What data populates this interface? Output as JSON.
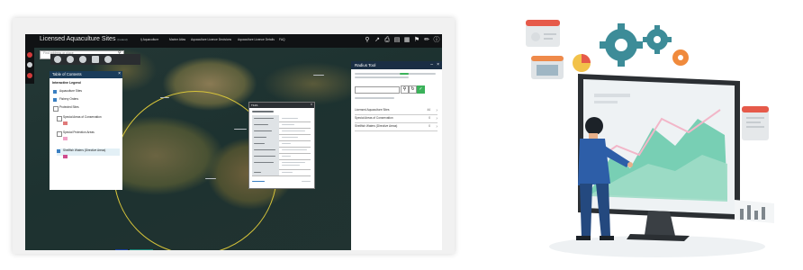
{
  "app": {
    "title": "Licensed Aquaculture Sites",
    "subtitle": "(Ireland)",
    "nav": [
      "i) Aquaculture",
      "Marine Atlas",
      "Aquaculture Licence Decisions",
      "Aquaculture Licence Details",
      "FAQ"
    ],
    "search_placeholder": "Find address or place"
  },
  "toc": {
    "title": "Table of Contents",
    "legend_title": "Interactive Legend",
    "items": [
      {
        "label": "Aquaculture Sites",
        "checked": true,
        "swatch_color": "#3a7fc2"
      },
      {
        "label": "Fishery Orders",
        "checked": true,
        "swatch_color": "#3a7fc2"
      },
      {
        "label": "Protected Sites",
        "checked": false,
        "swatch_color": ""
      },
      {
        "label": "Special Areas of Conservation",
        "checked": false,
        "swatch_color": "#e07a7a"
      },
      {
        "label": "Special Protection Areas",
        "checked": false,
        "swatch_color": "#f0a3c8"
      },
      {
        "label": "Shellfish Waters (Directive Areas)",
        "checked": true,
        "swatch_color": "#d04d8f"
      }
    ]
  },
  "popup": {
    "name": "T12/1"
  },
  "radius_tool": {
    "title": "Radius Tool",
    "results": [
      {
        "label": "Licensed Aquaculture Sites",
        "count": "44"
      },
      {
        "label": "Special Areas of Conservation",
        "count": "0"
      },
      {
        "label": "Shellfish Waters (Directive Areas)",
        "count": "0"
      }
    ]
  },
  "colors": {
    "toolbar_bg": "#101214",
    "panel_header": "#1a3c5a",
    "radius_circle": "#d7c43a",
    "monitor_screen": "#eef2f4",
    "chart_green": "#63c9a8",
    "gear_teal": "#3d8c98",
    "person_suit": "#2d5ea8"
  },
  "icons": [
    "search-icon",
    "share-icon",
    "print-icon",
    "layers-icon",
    "legend-icon",
    "bookmark-icon",
    "info-icon",
    "gear-icon",
    "chevron-right-icon",
    "close-icon"
  ]
}
